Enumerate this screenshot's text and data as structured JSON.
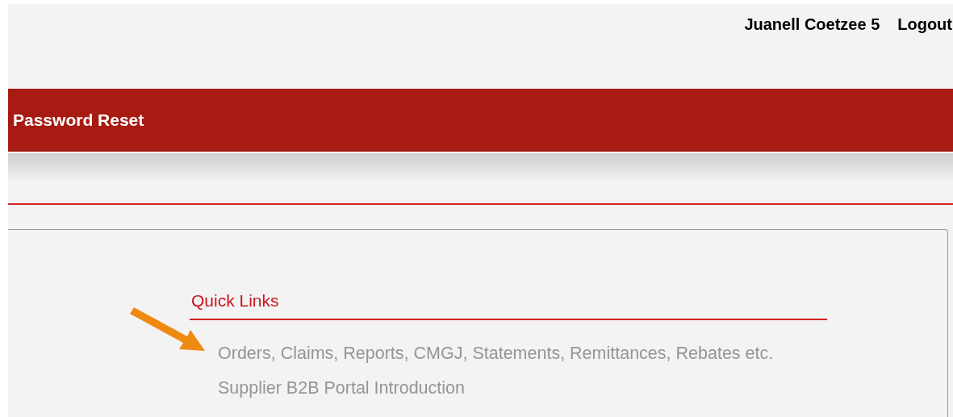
{
  "header": {
    "user_name": "Juanell Coetzee 5",
    "logout": "Logout"
  },
  "title_bar": {
    "title": "Password Reset"
  },
  "quick_links": {
    "heading": "Quick Links",
    "links": [
      "Orders, Claims, Reports, CMGJ, Statements, Remittances, Rebates etc.",
      "Supplier B2B Portal Introduction"
    ]
  }
}
